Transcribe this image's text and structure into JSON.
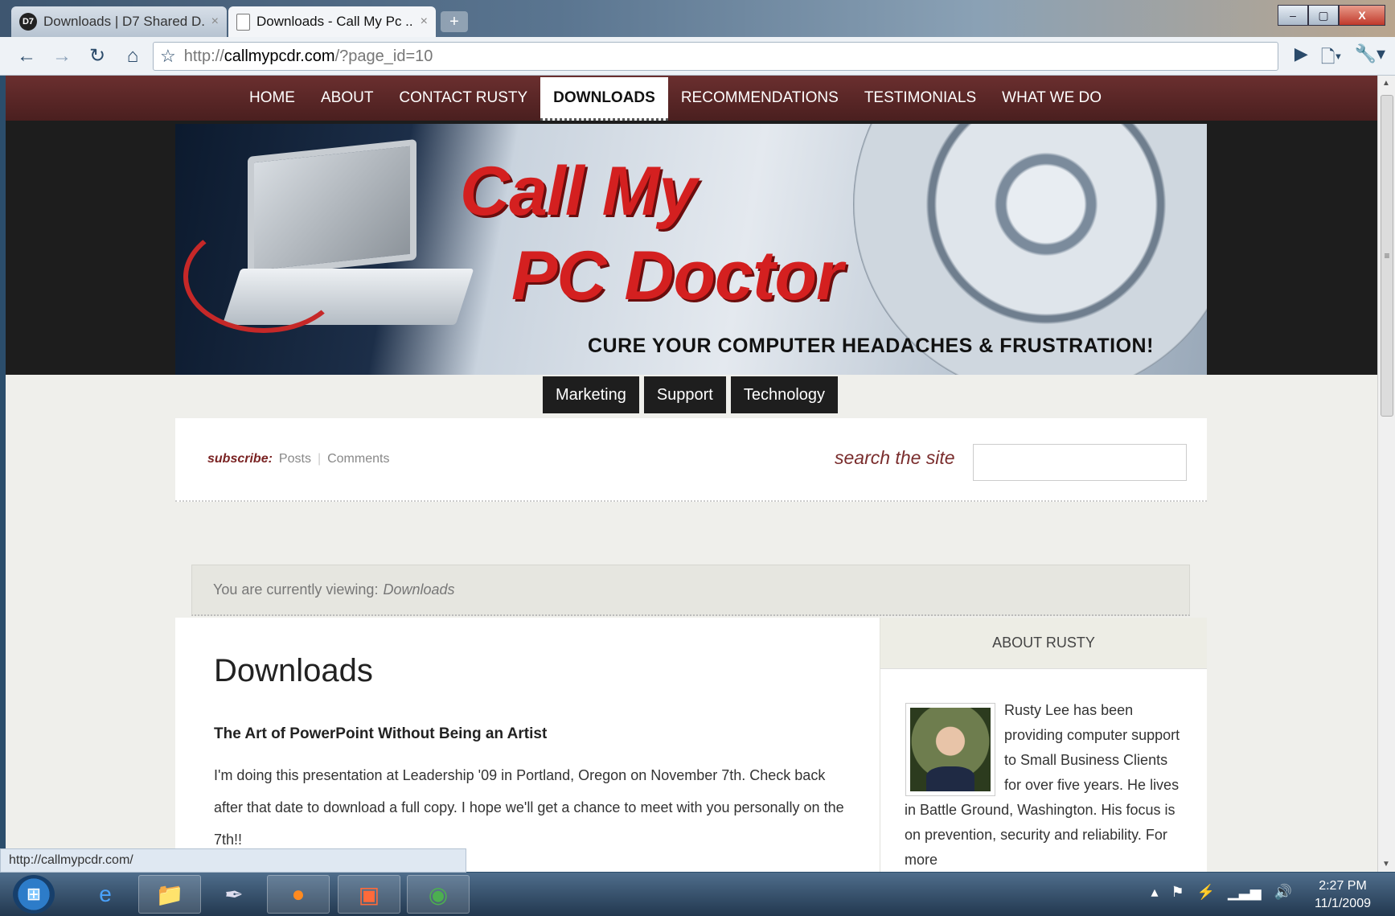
{
  "browser": {
    "tabs": [
      {
        "favicon": "D7",
        "title": "Downloads | D7 Shared D...",
        "close": "×"
      },
      {
        "favicon": "",
        "title": "Downloads - Call My Pc ...",
        "close": "×"
      }
    ],
    "new_tab": "+",
    "window_buttons": {
      "minimize": "–",
      "maximize": "▢",
      "close": "X"
    },
    "url_prefix": "http://",
    "url_domain": "callmypcdr.com",
    "url_path": "/?page_id=10",
    "status_url": "http://callmypcdr.com/"
  },
  "site": {
    "nav": [
      "HOME",
      "ABOUT",
      "CONTACT RUSTY",
      "DOWNLOADS",
      "RECOMMENDATIONS",
      "TESTIMONIALS",
      "WHAT WE DO"
    ],
    "nav_current": "DOWNLOADS",
    "banner": {
      "line1": "Call My",
      "line2": "PC Doctor",
      "tagline": "CURE YOUR COMPUTER HEADACHES & FRUSTRATION!"
    },
    "categories": [
      "Marketing",
      "Support",
      "Technology"
    ],
    "subscribe": {
      "label": "subscribe:",
      "posts": "Posts",
      "sep": "|",
      "comments": "Comments"
    },
    "search_label": "search the site",
    "breadcrumb": {
      "prefix": "You are currently viewing:",
      "current": "Downloads"
    },
    "post": {
      "title": "Downloads",
      "subtitle": "The Art of PowerPoint Without Being an Artist",
      "body": "I'm doing this presentation at Leadership '09 in Portland, Oregon on November 7th. Check back after that date to download a full copy.  I hope we'll get a chance to meet with you personally on the 7th!!"
    },
    "sidebar": {
      "heading": "ABOUT RUSTY",
      "bio": "Rusty Lee has been providing computer support to Small Business Clients for over five years. He lives in Battle Ground, Washington. His focus is on prevention, security and reliability. For more"
    }
  },
  "taskbar": {
    "time": "2:27 PM",
    "date": "11/1/2009"
  },
  "colors": {
    "nav_bg": "#5a2828",
    "brand_red": "#d42020",
    "label_maroon": "#7a2323"
  }
}
